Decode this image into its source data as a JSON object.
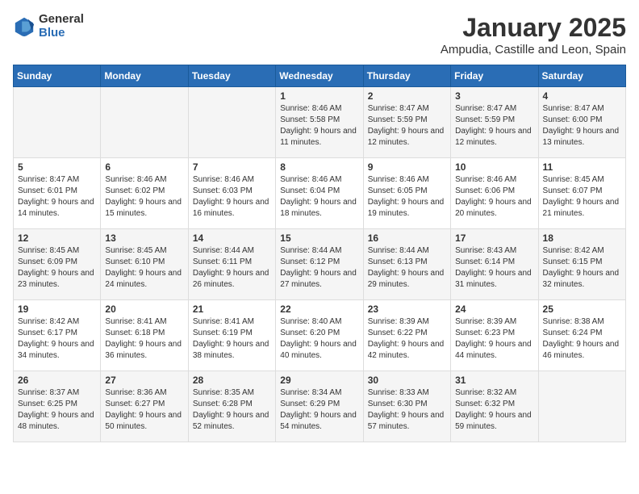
{
  "logo": {
    "general": "General",
    "blue": "Blue"
  },
  "title": "January 2025",
  "location": "Ampudia, Castille and Leon, Spain",
  "days_header": [
    "Sunday",
    "Monday",
    "Tuesday",
    "Wednesday",
    "Thursday",
    "Friday",
    "Saturday"
  ],
  "weeks": [
    [
      {
        "day": "",
        "content": ""
      },
      {
        "day": "",
        "content": ""
      },
      {
        "day": "",
        "content": ""
      },
      {
        "day": "1",
        "content": "Sunrise: 8:46 AM\nSunset: 5:58 PM\nDaylight: 9 hours and 11 minutes."
      },
      {
        "day": "2",
        "content": "Sunrise: 8:47 AM\nSunset: 5:59 PM\nDaylight: 9 hours and 12 minutes."
      },
      {
        "day": "3",
        "content": "Sunrise: 8:47 AM\nSunset: 5:59 PM\nDaylight: 9 hours and 12 minutes."
      },
      {
        "day": "4",
        "content": "Sunrise: 8:47 AM\nSunset: 6:00 PM\nDaylight: 9 hours and 13 minutes."
      }
    ],
    [
      {
        "day": "5",
        "content": "Sunrise: 8:47 AM\nSunset: 6:01 PM\nDaylight: 9 hours and 14 minutes."
      },
      {
        "day": "6",
        "content": "Sunrise: 8:46 AM\nSunset: 6:02 PM\nDaylight: 9 hours and 15 minutes."
      },
      {
        "day": "7",
        "content": "Sunrise: 8:46 AM\nSunset: 6:03 PM\nDaylight: 9 hours and 16 minutes."
      },
      {
        "day": "8",
        "content": "Sunrise: 8:46 AM\nSunset: 6:04 PM\nDaylight: 9 hours and 18 minutes."
      },
      {
        "day": "9",
        "content": "Sunrise: 8:46 AM\nSunset: 6:05 PM\nDaylight: 9 hours and 19 minutes."
      },
      {
        "day": "10",
        "content": "Sunrise: 8:46 AM\nSunset: 6:06 PM\nDaylight: 9 hours and 20 minutes."
      },
      {
        "day": "11",
        "content": "Sunrise: 8:45 AM\nSunset: 6:07 PM\nDaylight: 9 hours and 21 minutes."
      }
    ],
    [
      {
        "day": "12",
        "content": "Sunrise: 8:45 AM\nSunset: 6:09 PM\nDaylight: 9 hours and 23 minutes."
      },
      {
        "day": "13",
        "content": "Sunrise: 8:45 AM\nSunset: 6:10 PM\nDaylight: 9 hours and 24 minutes."
      },
      {
        "day": "14",
        "content": "Sunrise: 8:44 AM\nSunset: 6:11 PM\nDaylight: 9 hours and 26 minutes."
      },
      {
        "day": "15",
        "content": "Sunrise: 8:44 AM\nSunset: 6:12 PM\nDaylight: 9 hours and 27 minutes."
      },
      {
        "day": "16",
        "content": "Sunrise: 8:44 AM\nSunset: 6:13 PM\nDaylight: 9 hours and 29 minutes."
      },
      {
        "day": "17",
        "content": "Sunrise: 8:43 AM\nSunset: 6:14 PM\nDaylight: 9 hours and 31 minutes."
      },
      {
        "day": "18",
        "content": "Sunrise: 8:42 AM\nSunset: 6:15 PM\nDaylight: 9 hours and 32 minutes."
      }
    ],
    [
      {
        "day": "19",
        "content": "Sunrise: 8:42 AM\nSunset: 6:17 PM\nDaylight: 9 hours and 34 minutes."
      },
      {
        "day": "20",
        "content": "Sunrise: 8:41 AM\nSunset: 6:18 PM\nDaylight: 9 hours and 36 minutes."
      },
      {
        "day": "21",
        "content": "Sunrise: 8:41 AM\nSunset: 6:19 PM\nDaylight: 9 hours and 38 minutes."
      },
      {
        "day": "22",
        "content": "Sunrise: 8:40 AM\nSunset: 6:20 PM\nDaylight: 9 hours and 40 minutes."
      },
      {
        "day": "23",
        "content": "Sunrise: 8:39 AM\nSunset: 6:22 PM\nDaylight: 9 hours and 42 minutes."
      },
      {
        "day": "24",
        "content": "Sunrise: 8:39 AM\nSunset: 6:23 PM\nDaylight: 9 hours and 44 minutes."
      },
      {
        "day": "25",
        "content": "Sunrise: 8:38 AM\nSunset: 6:24 PM\nDaylight: 9 hours and 46 minutes."
      }
    ],
    [
      {
        "day": "26",
        "content": "Sunrise: 8:37 AM\nSunset: 6:25 PM\nDaylight: 9 hours and 48 minutes."
      },
      {
        "day": "27",
        "content": "Sunrise: 8:36 AM\nSunset: 6:27 PM\nDaylight: 9 hours and 50 minutes."
      },
      {
        "day": "28",
        "content": "Sunrise: 8:35 AM\nSunset: 6:28 PM\nDaylight: 9 hours and 52 minutes."
      },
      {
        "day": "29",
        "content": "Sunrise: 8:34 AM\nSunset: 6:29 PM\nDaylight: 9 hours and 54 minutes."
      },
      {
        "day": "30",
        "content": "Sunrise: 8:33 AM\nSunset: 6:30 PM\nDaylight: 9 hours and 57 minutes."
      },
      {
        "day": "31",
        "content": "Sunrise: 8:32 AM\nSunset: 6:32 PM\nDaylight: 9 hours and 59 minutes."
      },
      {
        "day": "",
        "content": ""
      }
    ]
  ]
}
